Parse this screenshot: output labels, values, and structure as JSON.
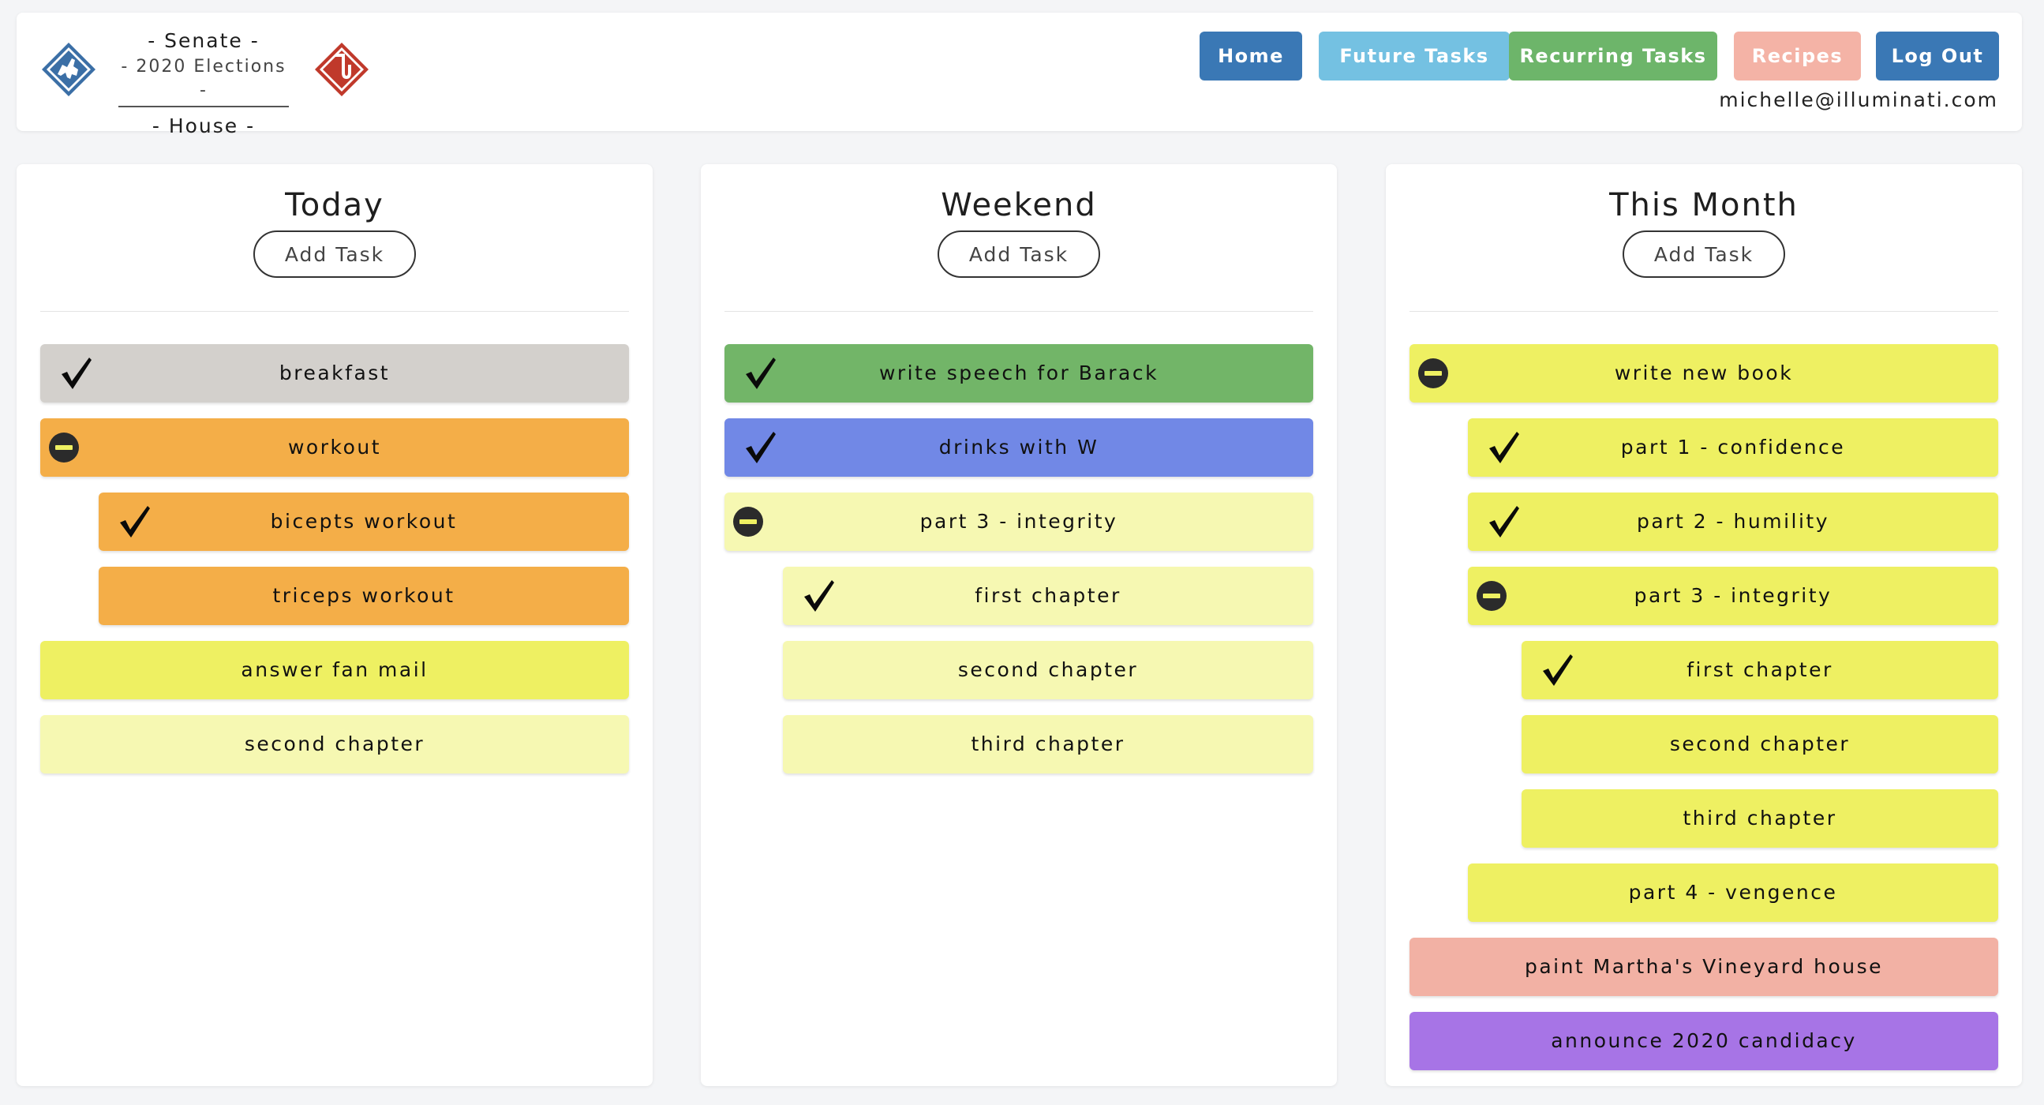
{
  "header": {
    "senate_label": "- Senate -",
    "elections_label": "- 2020 Elections -",
    "house_label": "- House -",
    "nav": {
      "home": "Home",
      "future": "Future Tasks",
      "recurring": "Recurring Tasks",
      "recipes": "Recipes",
      "logout": "Log Out"
    },
    "user_email": "michelle@illuminati.com"
  },
  "add_task_label": "Add Task",
  "colors": {
    "nav_primary": "#3a78b5",
    "nav_future": "#74c1e2",
    "nav_recurring": "#6db56a",
    "nav_recipes": "#f4b3a6",
    "task_gray": "#d3d0cc",
    "task_orange": "#f4ae48",
    "task_yellow": "#eef062",
    "task_pale_yellow": "#f6f8b2",
    "task_green": "#72b568",
    "task_blue": "#7188e6",
    "task_salmon": "#f2b1a4",
    "task_purple": "#a774e6"
  },
  "columns": [
    {
      "title": "Today",
      "tasks": [
        {
          "label": "breakfast",
          "status": "checked",
          "level": 0,
          "color": "#d3d0cc"
        },
        {
          "label": "workout",
          "status": "collapsed",
          "level": 0,
          "color": "#f4ae48"
        },
        {
          "label": "bicepts workout",
          "status": "checked",
          "level": 1,
          "color": "#f4ae48"
        },
        {
          "label": "triceps workout",
          "status": "none",
          "level": 1,
          "color": "#f4ae48"
        },
        {
          "label": "answer fan mail",
          "status": "none",
          "level": 0,
          "color": "#eef062"
        },
        {
          "label": "second chapter",
          "status": "none",
          "level": 0,
          "color": "#f6f8b2"
        }
      ]
    },
    {
      "title": "Weekend",
      "tasks": [
        {
          "label": "write speech for Barack",
          "status": "checked",
          "level": 0,
          "color": "#72b568"
        },
        {
          "label": "drinks with W",
          "status": "checked",
          "level": 0,
          "color": "#7188e6"
        },
        {
          "label": "part 3 - integrity",
          "status": "collapsed",
          "level": 0,
          "color": "#f6f8b2"
        },
        {
          "label": "first chapter",
          "status": "checked",
          "level": 1,
          "color": "#f6f8b2"
        },
        {
          "label": "second chapter",
          "status": "none",
          "level": 1,
          "color": "#f6f8b2"
        },
        {
          "label": "third chapter",
          "status": "none",
          "level": 1,
          "color": "#f6f8b2"
        }
      ]
    },
    {
      "title": "This Month",
      "tasks": [
        {
          "label": "write new book",
          "status": "collapsed",
          "level": 0,
          "color": "#eef062"
        },
        {
          "label": "part 1 - confidence",
          "status": "checked",
          "level": 1,
          "color": "#eef062"
        },
        {
          "label": "part 2 - humility",
          "status": "checked",
          "level": 1,
          "color": "#eef062"
        },
        {
          "label": "part 3 - integrity",
          "status": "collapsed",
          "level": 1,
          "color": "#eef062"
        },
        {
          "label": "first chapter",
          "status": "checked",
          "level": 2,
          "color": "#eef062"
        },
        {
          "label": "second chapter",
          "status": "none",
          "level": 2,
          "color": "#eef062"
        },
        {
          "label": "third chapter",
          "status": "none",
          "level": 2,
          "color": "#eef062"
        },
        {
          "label": "part 4 - vengence",
          "status": "none",
          "level": 1,
          "color": "#eef062"
        },
        {
          "label": "paint Martha's Vineyard house",
          "status": "none",
          "level": 0,
          "color": "#f2b1a4"
        },
        {
          "label": "announce 2020 candidacy",
          "status": "none",
          "level": 0,
          "color": "#a774e6"
        }
      ]
    }
  ]
}
